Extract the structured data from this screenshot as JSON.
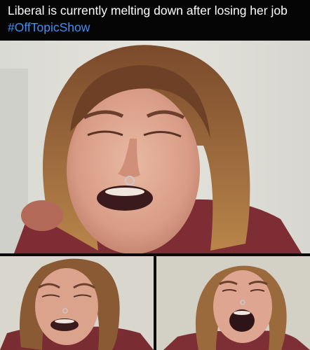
{
  "post": {
    "caption_text": "Liberal is currently melting down after losing her job ",
    "caption_hashtag": "#OffTopicShow"
  },
  "colors": {
    "background": "#0b0b0b",
    "caption_text": "#ffffff",
    "hashtag": "#3f8ef5"
  },
  "photos": [
    {
      "name": "main-photo",
      "description_icon": "crying-woman-closeup"
    },
    {
      "name": "bottom-left-photo",
      "description_icon": "crying-woman-closeup"
    },
    {
      "name": "bottom-right-photo",
      "description_icon": "screaming-woman-closeup"
    }
  ]
}
